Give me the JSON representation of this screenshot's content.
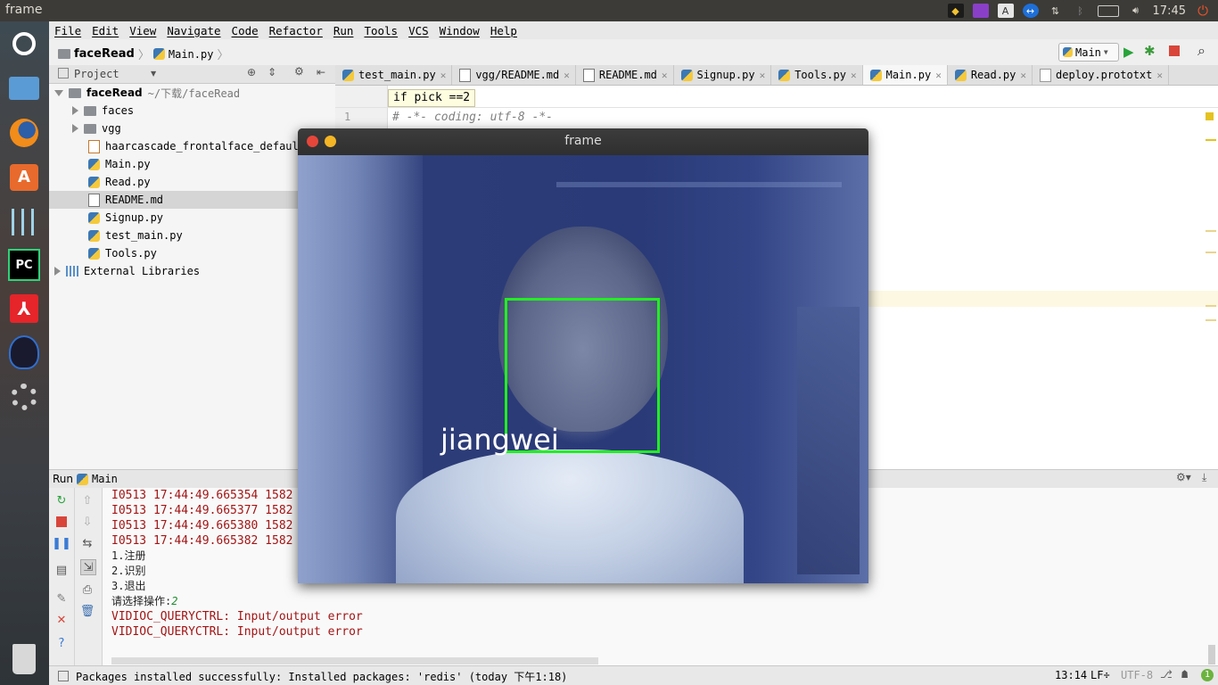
{
  "system": {
    "window_title": "frame",
    "clock": "17:45",
    "tray_icons": [
      "qq-penguin-icon",
      "screen-icon",
      "keyboard-a-icon",
      "teamviewer-icon",
      "network-arrows-icon",
      "bluetooth-icon",
      "battery-icon",
      "volume-icon",
      "power-icon"
    ],
    "keyboard_label": "A"
  },
  "launcher": {
    "items": [
      "ubuntu-dash-icon",
      "files-icon",
      "firefox-icon",
      "software-center-icon",
      "system-settings-sliders-icon",
      "pycharm-icon",
      "pdf-reader-icon",
      "qq-icon",
      "settings-gear-icon",
      "trash-icon"
    ],
    "pycharm_label": "PC"
  },
  "menu": [
    "File",
    "Edit",
    "View",
    "Navigate",
    "Code",
    "Refactor",
    "Run",
    "Tools",
    "VCS",
    "Window",
    "Help"
  ],
  "breadcrumb": {
    "project": "faceRead",
    "file": "Main.py"
  },
  "run_config": "Main",
  "project_panel": {
    "header": "Project",
    "root": {
      "name": "faceRead",
      "path": "~/下载/faceRead"
    },
    "items": [
      {
        "label": "faces",
        "type": "folder"
      },
      {
        "label": "vgg",
        "type": "folder"
      },
      {
        "label": "haarcascade_frontalface_default.xml",
        "type": "xml"
      },
      {
        "label": "Main.py",
        "type": "py"
      },
      {
        "label": "Read.py",
        "type": "py"
      },
      {
        "label": "README.md",
        "type": "md"
      },
      {
        "label": "Signup.py",
        "type": "py"
      },
      {
        "label": "test_main.py",
        "type": "py"
      },
      {
        "label": "Tools.py",
        "type": "py"
      }
    ],
    "external": "External Libraries"
  },
  "tabs": [
    {
      "label": "test_main.py",
      "type": "py"
    },
    {
      "label": "vgg/README.md",
      "type": "md"
    },
    {
      "label": "README.md",
      "type": "md"
    },
    {
      "label": "Signup.py",
      "type": "py"
    },
    {
      "label": "Tools.py",
      "type": "py"
    },
    {
      "label": "Main.py",
      "type": "py",
      "active": true
    },
    {
      "label": "Read.py",
      "type": "py"
    },
    {
      "label": "deploy.prototxt",
      "type": "txt"
    }
  ],
  "editor": {
    "hint": "if pick ==2",
    "line_number": "1",
    "code": "# -*- coding: utf-8 -*-"
  },
  "run_panel": {
    "label": "Run",
    "config": "Main",
    "lines": [
      {
        "text": "I0513 17:44:49.665354 1582",
        "kind": "err"
      },
      {
        "text": "I0513 17:44:49.665377 1582",
        "kind": "err"
      },
      {
        "text": "I0513 17:44:49.665380 1582",
        "kind": "err"
      },
      {
        "text": "I0513 17:44:49.665382 1582",
        "kind": "err"
      },
      {
        "text": "1.注册",
        "kind": "out"
      },
      {
        "text": "2.识别",
        "kind": "out"
      },
      {
        "text": "3.退出",
        "kind": "out"
      },
      {
        "text": "请选择操作:",
        "kind": "out",
        "input": "2"
      },
      {
        "text": "VIDIOC_QUERYCTRL: Input/output error",
        "kind": "err"
      },
      {
        "text": "VIDIOC_QUERYCTRL: Input/output error",
        "kind": "err"
      }
    ]
  },
  "status": {
    "message": "Packages installed successfully: Installed packages: 'redis' (today 下午1:18)",
    "position": "13:14",
    "line_sep": "LF÷",
    "encoding": "UTF-8",
    "notifications": "1"
  },
  "frame_window": {
    "title": "frame",
    "face_label": "jiangwei",
    "box_color": "#22ee22"
  },
  "colors": {
    "accent_green": "#22ee22",
    "error_red": "#a31515",
    "ide_bg": "#f2f2f2"
  }
}
